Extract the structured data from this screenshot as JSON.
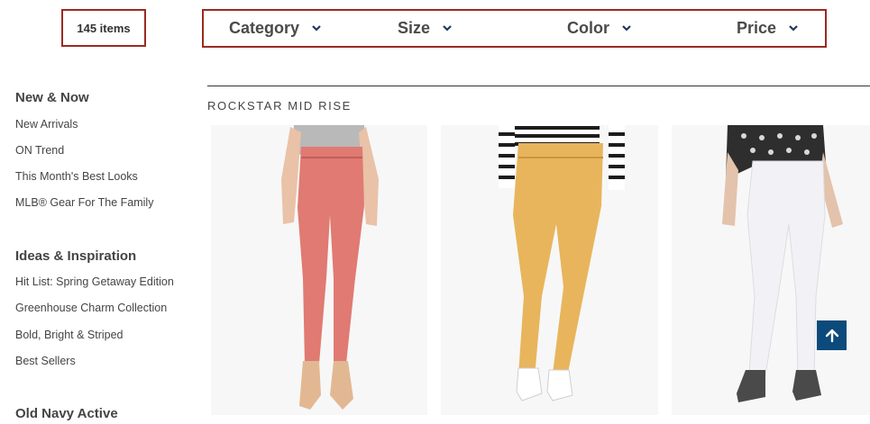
{
  "item_count": "145 items",
  "filters": [
    {
      "label": "Category",
      "icon": "chevron-down-icon"
    },
    {
      "label": "Size",
      "icon": "chevron-down-icon"
    },
    {
      "label": "Color",
      "icon": "chevron-down-icon"
    },
    {
      "label": "Price",
      "icon": "chevron-down-icon"
    }
  ],
  "sidebar": {
    "sections": [
      {
        "title": "New & Now",
        "links": [
          "New Arrivals",
          "ON Trend",
          "This Month's Best Looks",
          "MLB® Gear For The Family"
        ]
      },
      {
        "title": "Ideas & Inspiration",
        "links": [
          "Hit List: Spring Getaway Edition",
          "Greenhouse Charm Collection",
          "Bold, Bright & Striped",
          "Best Sellers"
        ]
      },
      {
        "title": "Old Navy Active",
        "links": []
      }
    ]
  },
  "section_title": "ROCKSTAR MID RISE",
  "products": [
    {
      "jeans_color": "#e07a72",
      "top": "gray-tee",
      "shoes": "nude-heels"
    },
    {
      "jeans_color": "#e8b55c",
      "top": "striped-sweater",
      "shoes": "white-sneakers"
    },
    {
      "jeans_color": "#f2f2f6",
      "top": "patterned-sweater",
      "shoes": "gray-slipons"
    }
  ],
  "scroll_top_icon": "arrow-up-icon",
  "colors": {
    "accent_border": "#9b2a22",
    "scroll_button": "#0b4a7a"
  }
}
